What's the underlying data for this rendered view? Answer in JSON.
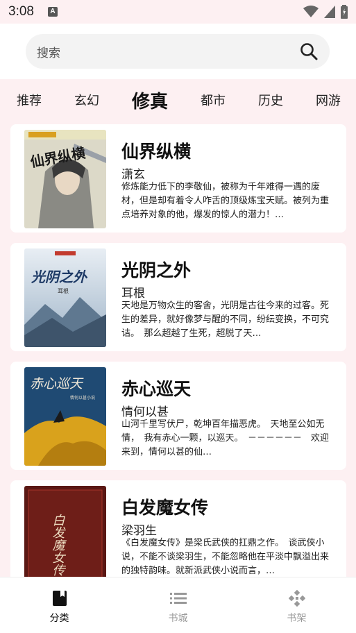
{
  "status_bar": {
    "time": "3:08",
    "notification_letter": "A"
  },
  "search": {
    "placeholder": "搜索"
  },
  "tabs": [
    {
      "label": "推荐",
      "active": false
    },
    {
      "label": "玄幻",
      "active": false
    },
    {
      "label": "修真",
      "active": true
    },
    {
      "label": "都市",
      "active": false
    },
    {
      "label": "历史",
      "active": false
    },
    {
      "label": "网游",
      "active": false
    }
  ],
  "books": [
    {
      "title": "仙界纵横",
      "author": "潇玄",
      "description": "修炼能力低下的李敬仙，被称为千年难得一遇的废材，但是却有着令人咋舌的顶级炼宝天赋。被列为重点培养对象的他，爆发的惊人的潜力！…",
      "cover_text": "仙界纵横"
    },
    {
      "title": "光阴之外",
      "author": "耳根",
      "description": "天地是万物众生的客舍，光阴是古往今来的过客。死生的差异，就好像梦与醒的不同，纷纭变换，不可究诘。　那么超越了生死，超脱了天…",
      "cover_text": "光阴之外",
      "cover_subtext": "耳根"
    },
    {
      "title": "赤心巡天",
      "author": "情何以甚",
      "description": "山河千里写伏尸，乾坤百年描恶虎。　天地至公如无情，　我有赤心一颗，以巡天。　－－－－－－　欢迎来到，情何以甚的仙…",
      "cover_text": "赤心巡天",
      "cover_subtext": "情何以甚小说"
    },
    {
      "title": "白发魔女传",
      "author": "梁羽生",
      "description": "《白发魔女传》是梁氏武侠的扛鼎之作。　谈武侠小说，不能不谈梁羽生，不能忽略他在平淡中飘溢出来的独特韵味。就新派武侠小说而言，…",
      "cover_text": "白发魔女传"
    }
  ],
  "bottom_nav": [
    {
      "label": "分类",
      "icon": "book-icon",
      "active": true
    },
    {
      "label": "书城",
      "icon": "list-icon",
      "active": false
    },
    {
      "label": "书架",
      "icon": "gamepad-icon",
      "active": false
    }
  ],
  "colors": {
    "background": "#fdf0f2",
    "active_nav": "#111111",
    "inactive_nav": "#999999"
  }
}
